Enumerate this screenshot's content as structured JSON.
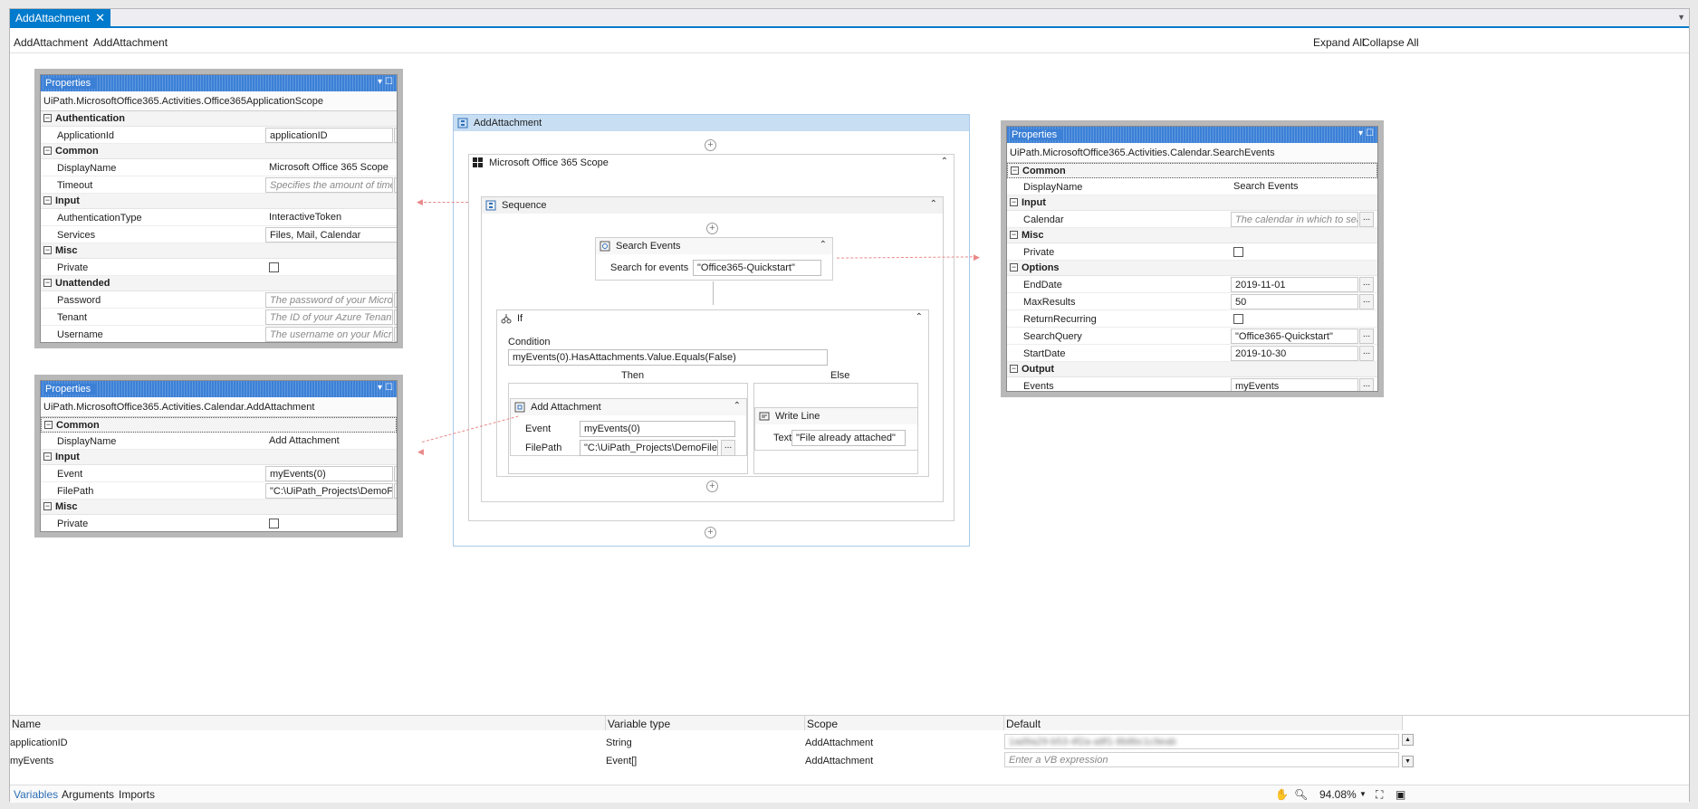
{
  "tab": {
    "title": "AddAttachment",
    "close": "✕"
  },
  "breadcrumb": [
    "AddAttachment",
    "AddAttachment"
  ],
  "breadcrumb_sep": "›",
  "toolbar": {
    "expand_all": "Expand All",
    "collapse_all": "Collapse All"
  },
  "props1": {
    "title": "Properties",
    "type": "UiPath.MicrosoftOffice365.Activities.Office365ApplicationScope",
    "cats": {
      "authentication": "Authentication",
      "common": "Common",
      "input": "Input",
      "misc": "Misc",
      "unattended": "Unattended"
    },
    "rows": {
      "application_id": {
        "name": "ApplicationId",
        "value": "applicationID"
      },
      "display_name": {
        "name": "DisplayName",
        "value": "Microsoft Office 365 Scope"
      },
      "timeout": {
        "name": "Timeout",
        "placeholder": "Specifies the amount of time (in r"
      },
      "auth_type": {
        "name": "AuthenticationType",
        "value": "InteractiveToken"
      },
      "services": {
        "name": "Services",
        "value": "Files, Mail, Calendar"
      },
      "private": {
        "name": "Private"
      },
      "password": {
        "name": "Password",
        "placeholder": "The password of your Microsoft C"
      },
      "tenant": {
        "name": "Tenant",
        "placeholder": "The ID of your Azure Tenant. For"
      },
      "username": {
        "name": "Username",
        "placeholder": "The username on your Microsoft"
      }
    }
  },
  "props2": {
    "title": "Properties",
    "type": "UiPath.MicrosoftOffice365.Activities.Calendar.AddAttachment",
    "cats": {
      "common": "Common",
      "input": "Input",
      "misc": "Misc"
    },
    "rows": {
      "display_name": {
        "name": "DisplayName",
        "value": "Add Attachment"
      },
      "event": {
        "name": "Event",
        "value": "myEvents(0)"
      },
      "file_path": {
        "name": "FilePath",
        "value": "\"C:\\UiPath_Projects\\DemoFile.dc"
      },
      "private": {
        "name": "Private"
      }
    }
  },
  "props3": {
    "title": "Properties",
    "type": "UiPath.MicrosoftOffice365.Activities.Calendar.SearchEvents",
    "cats": {
      "common": "Common",
      "input": "Input",
      "misc": "Misc",
      "options": "Options",
      "output": "Output"
    },
    "rows": {
      "display_name": {
        "name": "DisplayName",
        "value": "Search Events"
      },
      "calendar": {
        "name": "Calendar",
        "placeholder": "The calendar in which to search."
      },
      "private": {
        "name": "Private"
      },
      "end_date": {
        "name": "EndDate",
        "value": "2019-11-01"
      },
      "max_results": {
        "name": "MaxResults",
        "value": "50"
      },
      "return_recurring": {
        "name": "ReturnRecurring"
      },
      "search_query": {
        "name": "SearchQuery",
        "value": "\"Office365-Quickstart\""
      },
      "start_date": {
        "name": "StartDate",
        "value": "2019-10-30"
      },
      "events": {
        "name": "Events",
        "value": "myEvents"
      }
    }
  },
  "workflow": {
    "root": "AddAttachment",
    "scope": "Microsoft Office 365 Scope",
    "sequence": "Sequence",
    "search": {
      "title": "Search Events",
      "label": "Search for events",
      "value": "\"Office365-Quickstart\""
    },
    "if": {
      "title": "If",
      "condition_label": "Condition",
      "condition": "myEvents(0).HasAttachments.Value.Equals(False)",
      "then": "Then",
      "else": "Else"
    },
    "add_attachment": {
      "title": "Add Attachment",
      "event_label": "Event",
      "event_value": "myEvents(0)",
      "file_label": "FilePath",
      "file_value": "\"C:\\UiPath_Projects\\DemoFile.docx"
    },
    "write_line": {
      "title": "Write Line",
      "label": "Text",
      "value": "\"File already attached\""
    }
  },
  "variables": {
    "headers": [
      "Name",
      "Variable type",
      "Scope",
      "Default"
    ],
    "rows": [
      {
        "name": "applicationID",
        "type": "String",
        "scope": "AddAttachment",
        "default": "1ad9a29-b53-4f2a-a8f1-8b8bc1c9eab"
      },
      {
        "name": "myEvents",
        "type": "Event[]",
        "scope": "AddAttachment",
        "default": "Enter a VB expression"
      }
    ]
  },
  "bottom": {
    "tabs": [
      "Variables",
      "Arguments",
      "Imports"
    ],
    "zoom": "94.08%"
  },
  "colors": {
    "accent": "#007acc",
    "title_blue": "#3c80d6",
    "arrow": "#e9898a"
  }
}
